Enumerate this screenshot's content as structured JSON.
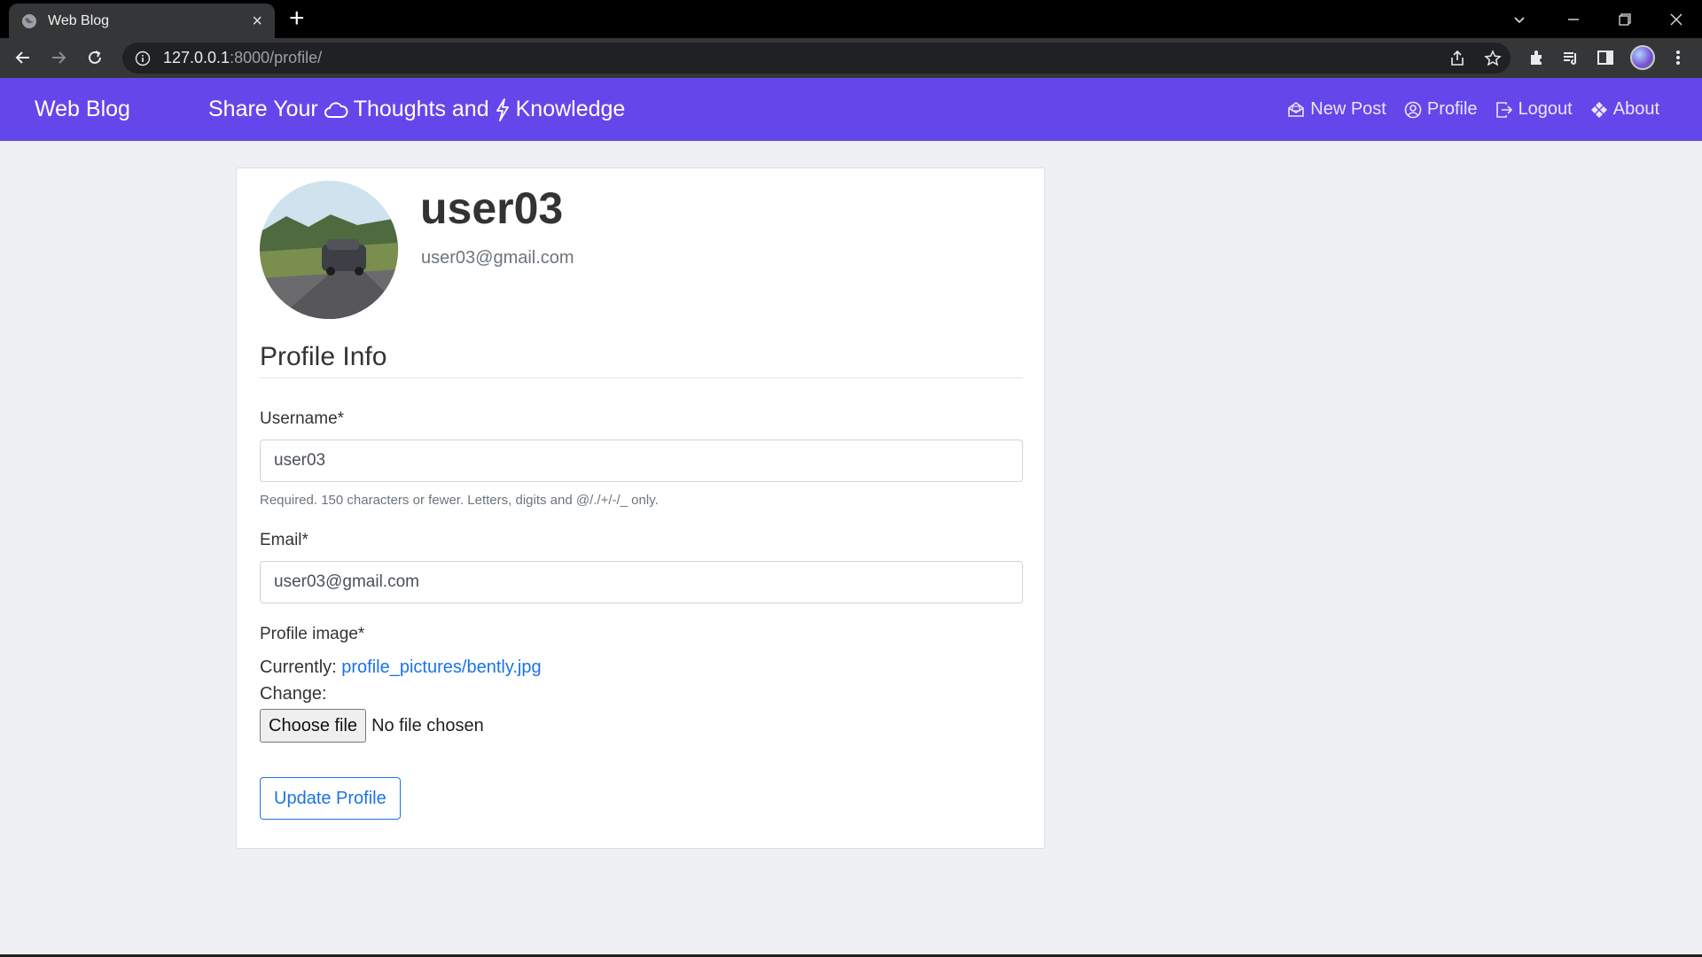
{
  "browser": {
    "tab_title": "Web Blog",
    "tab_close": "×",
    "new_tab": "+",
    "url_host": "127.0.0.1",
    "url_path": ":8000/profile/"
  },
  "navbar": {
    "brand": "Web Blog",
    "tagline_part1": "Share Your",
    "tagline_part2": "Thoughts and",
    "tagline_part3": "Knowledge",
    "links": {
      "new_post": "New Post",
      "profile": "Profile",
      "logout": "Logout",
      "about": "About"
    },
    "color": "#6447ea"
  },
  "profile": {
    "username": "user03",
    "email": "user03@gmail.com"
  },
  "form": {
    "legend": "Profile Info",
    "username_label": "Username*",
    "username_value": "user03",
    "username_help": "Required. 150 characters or fewer. Letters, digits and @/./+/-/_ only.",
    "email_label": "Email*",
    "email_value": "user03@gmail.com",
    "image_label": "Profile image*",
    "currently_label": "Currently:",
    "currently_link": "profile_pictures/bently.jpg",
    "change_label": "Change:",
    "choose_file": "Choose file",
    "no_file": "No file chosen",
    "submit": "Update Profile"
  }
}
